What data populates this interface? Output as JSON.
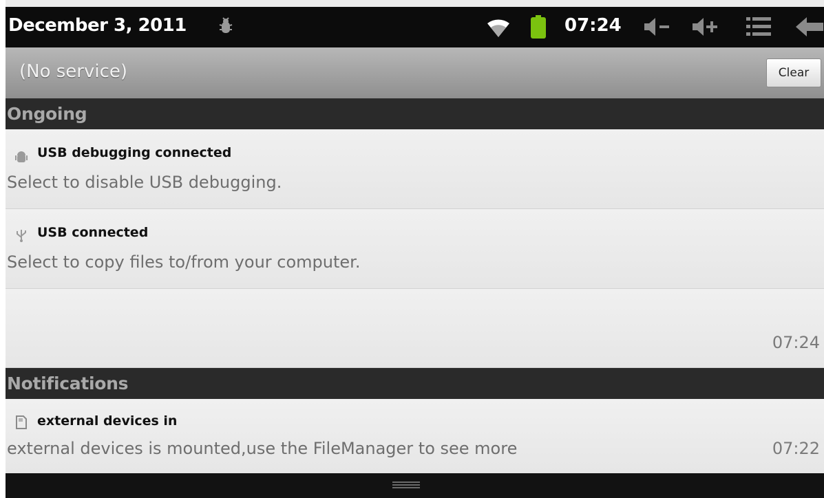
{
  "status_bar": {
    "date": "December 3, 2011",
    "time": "07:24",
    "icons": [
      "debug-bug-icon",
      "wifi-icon",
      "battery-icon",
      "volume-down-icon",
      "volume-up-icon",
      "menu-icon",
      "back-icon"
    ],
    "battery_color": "#7bc20f"
  },
  "carrier": {
    "label": "(No service)",
    "clear_label": "Clear"
  },
  "sections": {
    "ongoing_title": "Ongoing",
    "notifications_title": "Notifications"
  },
  "ongoing": [
    {
      "icon": "android-debug-icon",
      "title": "USB debugging connected",
      "text": "Select to disable USB debugging."
    },
    {
      "icon": "usb-icon",
      "title": "USB connected",
      "text": "Select to copy files to/from your computer."
    },
    {
      "time": "07:24"
    }
  ],
  "notifications": [
    {
      "icon": "sd-card-icon",
      "title": "external devices in",
      "text": "external devices is mounted,use the FileManager to see more",
      "time": "07:22"
    }
  ]
}
